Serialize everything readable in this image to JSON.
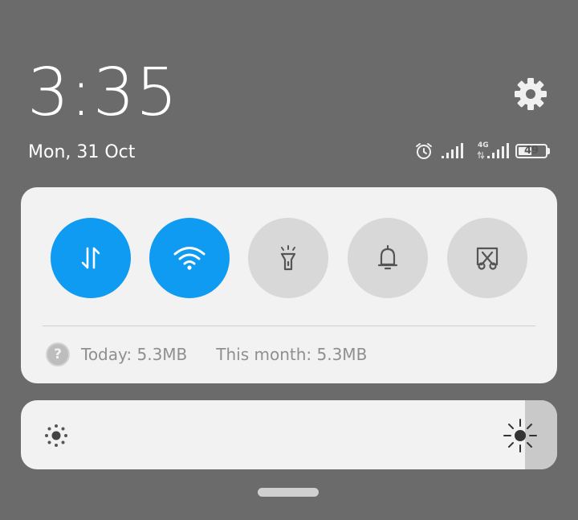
{
  "header": {
    "time": "3:35",
    "date": "Mon, 31 Oct",
    "settings_icon": "gear-icon"
  },
  "status_bar": {
    "alarm_icon": "alarm-clock-icon",
    "signal_1_icon": "signal-bars-icon",
    "network_label": "4G",
    "signal_2_icon": "signal-bars-icon",
    "battery_level": "49",
    "battery_fraction": 0.49
  },
  "quick_toggles": [
    {
      "name": "mobile-data",
      "icon": "mobile-data-arrows-icon",
      "active": true
    },
    {
      "name": "wifi",
      "icon": "wifi-icon",
      "active": true
    },
    {
      "name": "flashlight",
      "icon": "flashlight-icon",
      "active": false
    },
    {
      "name": "sound",
      "icon": "bell-icon",
      "active": false
    },
    {
      "name": "screenshot",
      "icon": "screenshot-scissors-icon",
      "active": false
    }
  ],
  "data_usage": {
    "help_icon": "question-mark-icon",
    "help_glyph": "?",
    "today": "Today: 5.3MB",
    "month": "This month: 5.3MB"
  },
  "brightness": {
    "level_fraction": 0.94,
    "low_icon": "brightness-low-icon",
    "high_icon": "brightness-high-icon"
  },
  "colors": {
    "background": "#6b6b6b",
    "panel": "#f2f2f2",
    "accent": "#0f9bf2",
    "toggle_off": "#d8d8d8"
  }
}
